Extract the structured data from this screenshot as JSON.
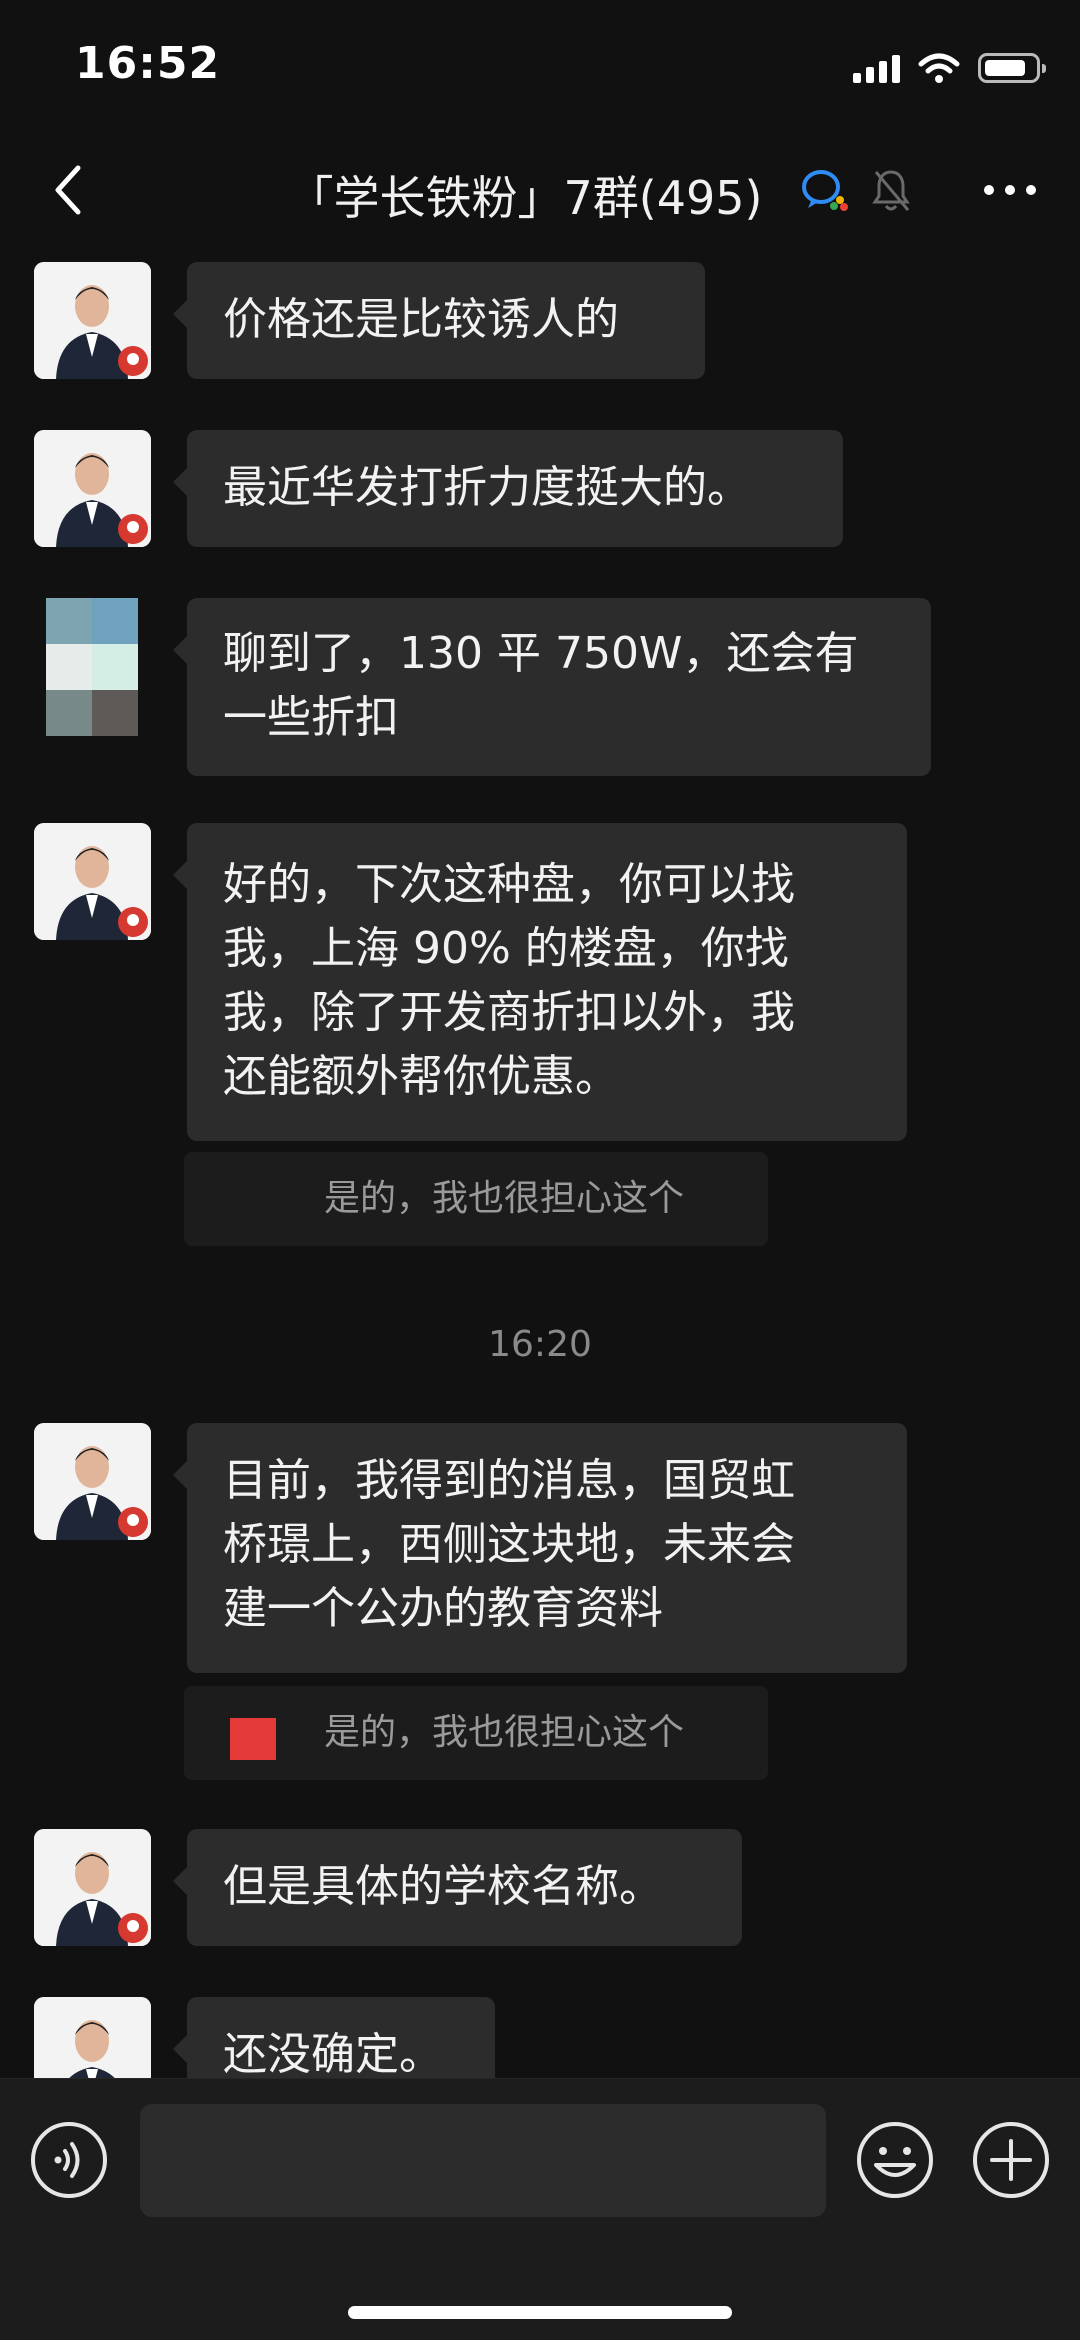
{
  "status_bar": {
    "time": "16:52"
  },
  "header": {
    "title": "「学长铁粉」7群(495)"
  },
  "messages": [
    {
      "text": "价格还是比较诱人的"
    },
    {
      "text": "最近华发打折力度挺大的。"
    },
    {
      "line1": "聊到了，130 平 750W，还会有",
      "line2": "一些折扣"
    },
    {
      "line1": "好的，下次这种盘，你可以找",
      "line2": "我，上海 90% 的楼盘，你找",
      "line3": "我，除了开发商折扣以外，我",
      "line4": "还能额外帮你优惠。"
    },
    {
      "line1": "目前，我得到的消息，国贸虹",
      "line2": "桥璟上，西侧这块地，未来会",
      "line3": "建一个公办的教育资料"
    },
    {
      "text": "但是具体的学校名称。"
    },
    {
      "text": "还没确定。"
    }
  ],
  "quotes": [
    {
      "text": "是的，我也很担心这个"
    },
    {
      "text": "是的，我也很担心这个"
    }
  ],
  "time_divider": "16:20",
  "input": {
    "placeholder": ""
  },
  "colors": {
    "background": "#111111",
    "bubble": "#2c2c2c",
    "quote_mark": "#e53a3a"
  }
}
